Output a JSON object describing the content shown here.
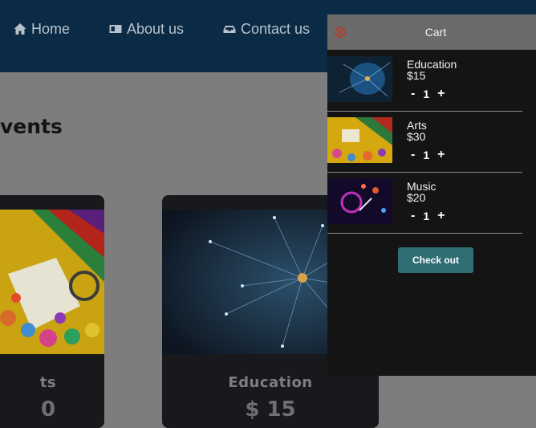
{
  "nav": {
    "items": [
      {
        "label": "Home",
        "icon": "home-icon"
      },
      {
        "label": "About us",
        "icon": "id-card-icon"
      },
      {
        "label": "Contact us",
        "icon": "inbox-icon"
      }
    ]
  },
  "main": {
    "heading": "vents",
    "cards": [
      {
        "title": "ts",
        "price": "0"
      },
      {
        "title": "Education",
        "price": "$ 15"
      }
    ]
  },
  "cart": {
    "title": "Cart",
    "close_icon": "close-icon",
    "items": [
      {
        "name": "Education",
        "price": "$15",
        "qty": "1",
        "minus": "-",
        "plus": "+"
      },
      {
        "name": "Arts",
        "price": "$30",
        "qty": "1",
        "minus": "-",
        "plus": "+"
      },
      {
        "name": "Music",
        "price": "$20",
        "qty": "1",
        "minus": "-",
        "plus": "+"
      }
    ],
    "checkout_label": "Check out"
  },
  "colors": {
    "navbar": "#0b2a45",
    "overlay": "#7d7d7d",
    "cart_bg": "#141414",
    "cart_header": "#6a6a6a",
    "checkout": "#2f6e73",
    "close": "#c0392b"
  }
}
